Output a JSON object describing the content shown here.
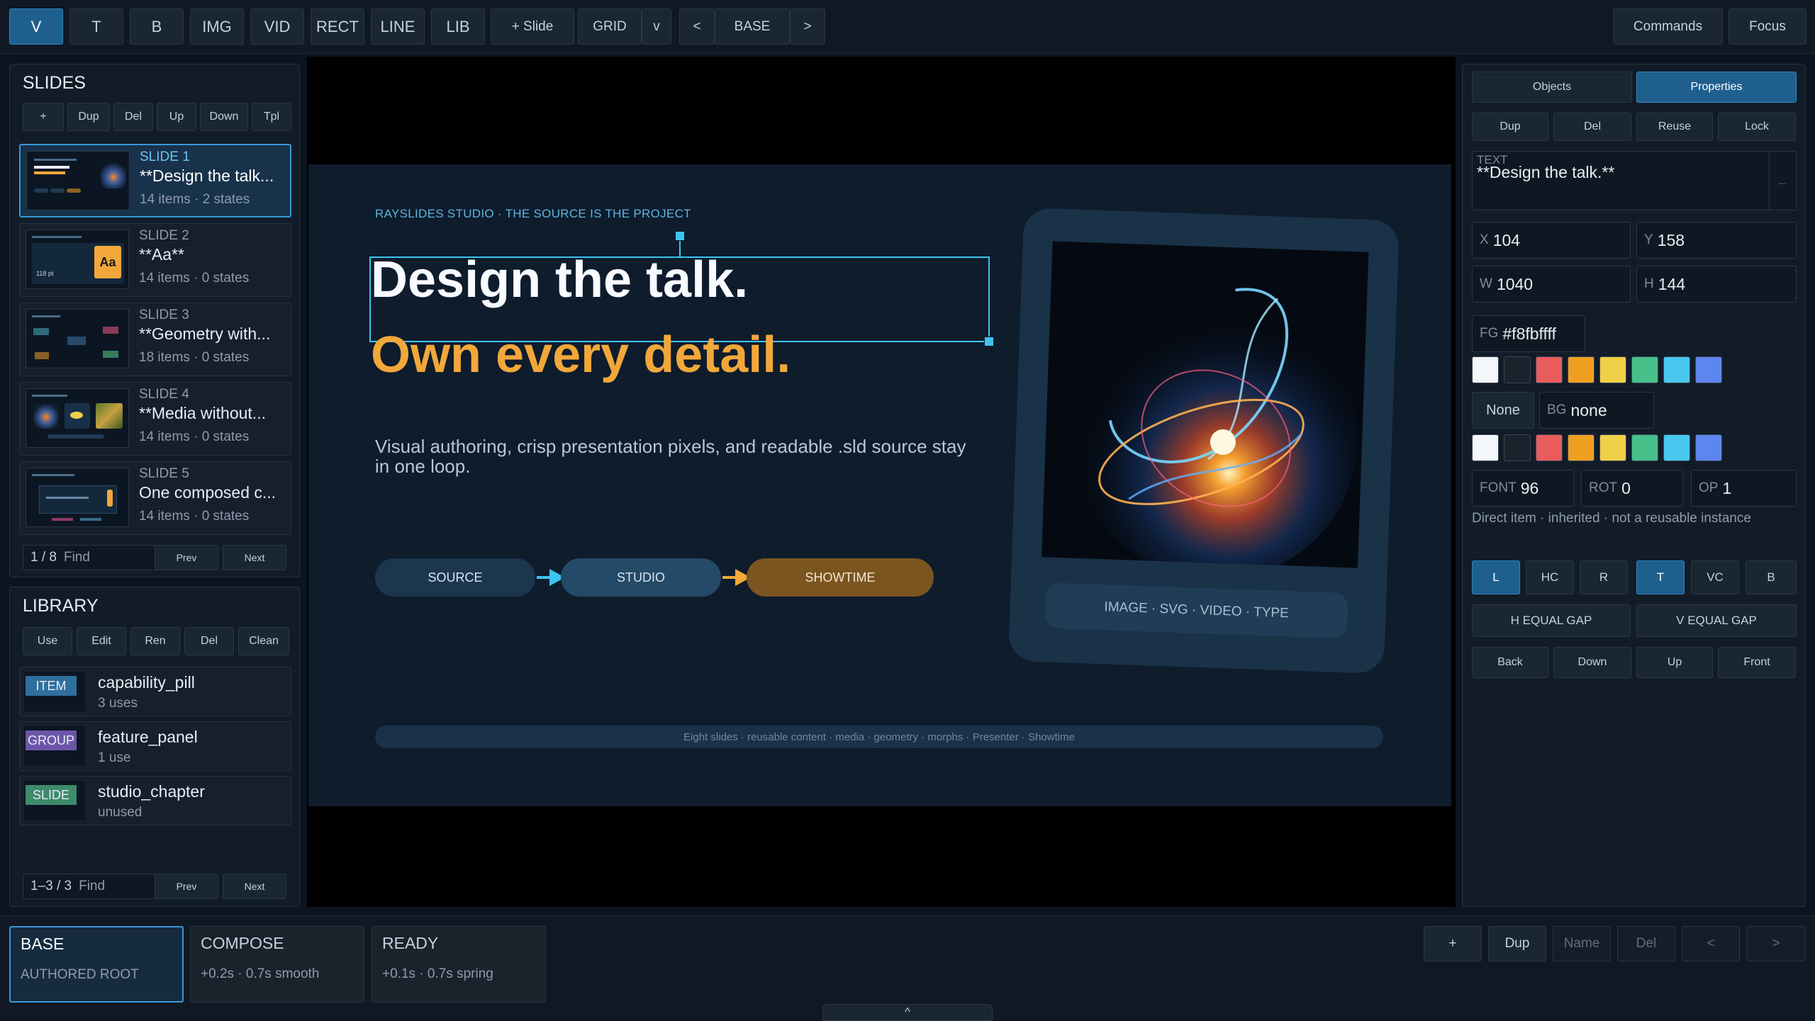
{
  "toolbar": {
    "tools": [
      "V",
      "T",
      "B",
      "IMG",
      "VID",
      "RECT",
      "LINE",
      "LIB"
    ],
    "add_slide": "+ Slide",
    "grid": "GRID",
    "grid_toggle": "v",
    "prev": "<",
    "state": "BASE",
    "next": ">",
    "commands": "Commands",
    "focus": "Focus"
  },
  "slides_panel": {
    "title": "SLIDES",
    "actions": [
      "+",
      "Dup",
      "Del",
      "Up",
      "Down",
      "Tpl"
    ],
    "items": [
      {
        "num": "SLIDE 1",
        "title": "**Design the talk...",
        "meta": "14 items · 2 states"
      },
      {
        "num": "SLIDE 2",
        "title": "**Aa**",
        "meta": "14 items · 0 states"
      },
      {
        "num": "SLIDE 3",
        "title": "**Geometry with...",
        "meta": "18 items · 0 states"
      },
      {
        "num": "SLIDE 4",
        "title": "**Media without...",
        "meta": "14 items · 0 states"
      },
      {
        "num": "SLIDE 5",
        "title": "One composed c...",
        "meta": "14 items · 0 states"
      }
    ],
    "thumb2_badge": "Aa",
    "thumb2_label": "118 pt",
    "find_value": "1 / 8",
    "find_placeholder": "Find",
    "prev": "Prev",
    "next": "Next"
  },
  "library_panel": {
    "title": "LIBRARY",
    "actions": [
      "Use",
      "Edit",
      "Ren",
      "Del",
      "Clean"
    ],
    "items": [
      {
        "badge": "ITEM",
        "name": "capability_pill",
        "meta": "3 uses",
        "color": "#2f6f9e"
      },
      {
        "badge": "GROUP",
        "name": "feature_panel",
        "meta": "1 use",
        "color": "#6b55a8"
      },
      {
        "badge": "SLIDE",
        "name": "studio_chapter",
        "meta": "unused",
        "color": "#3e8a6a"
      }
    ],
    "find_value": "1–3 / 3",
    "find_placeholder": "Find",
    "prev": "Prev",
    "next": "Next"
  },
  "slide": {
    "kicker": "RAYSLIDES STUDIO · THE SOURCE IS THE PROJECT",
    "headline": "Design the talk.",
    "subheadline": "Own every detail.",
    "body": "Visual authoring, crisp presentation pixels, and readable .sld source stay in one loop.",
    "pills": [
      "SOURCE",
      "STUDIO",
      "SHOWTIME"
    ],
    "card_caption": "IMAGE · SVG · VIDEO · TYPE",
    "footer": "Eight slides · reusable content · media · geometry · morphs · Presenter · Showtime"
  },
  "inspector": {
    "tabs": [
      "Objects",
      "Properties"
    ],
    "actions": [
      "Dup",
      "Del",
      "Reuse",
      "Lock"
    ],
    "text_label": "TEXT",
    "text_value": "**Design the talk.**",
    "text_more": "...",
    "x_label": "X",
    "x": "104",
    "y_label": "Y",
    "y": "158",
    "w_label": "W",
    "w": "1040",
    "h_label": "H",
    "h": "144",
    "fg_label": "FG",
    "fg": "#f8fbffff",
    "none_btn": "None",
    "bg_label": "BG",
    "bg": "none",
    "font_label": "FONT",
    "font": "96",
    "rot_label": "ROT",
    "rot": "0",
    "op_label": "OP",
    "op": "1",
    "hint": "Direct item · inherited · not a reusable instance",
    "align": [
      "L",
      "HC",
      "R",
      "T",
      "VC",
      "B"
    ],
    "h_equal_gap": "H EQUAL GAP",
    "v_equal_gap": "V EQUAL GAP",
    "order": [
      "Back",
      "Down",
      "Up",
      "Front"
    ],
    "swatches": [
      "#f4f6fa",
      "#1a222c",
      "#e85c5c",
      "#f0a020",
      "#f2cf48",
      "#48c08a",
      "#48c8ee",
      "#5e86f0"
    ]
  },
  "states_bar": {
    "states": [
      {
        "name": "BASE",
        "detail": "AUTHORED ROOT"
      },
      {
        "name": "COMPOSE",
        "detail": "+0.2s · 0.7s smooth"
      },
      {
        "name": "READY",
        "detail": "+0.1s · 0.7s spring"
      }
    ],
    "actions": [
      "+",
      "Dup",
      "Name",
      "Del",
      "<",
      ">"
    ],
    "collapse": "^"
  },
  "colors": {
    "accent": "#2f86c0",
    "orange": "#f2a73a",
    "bg": "#0b1420"
  }
}
